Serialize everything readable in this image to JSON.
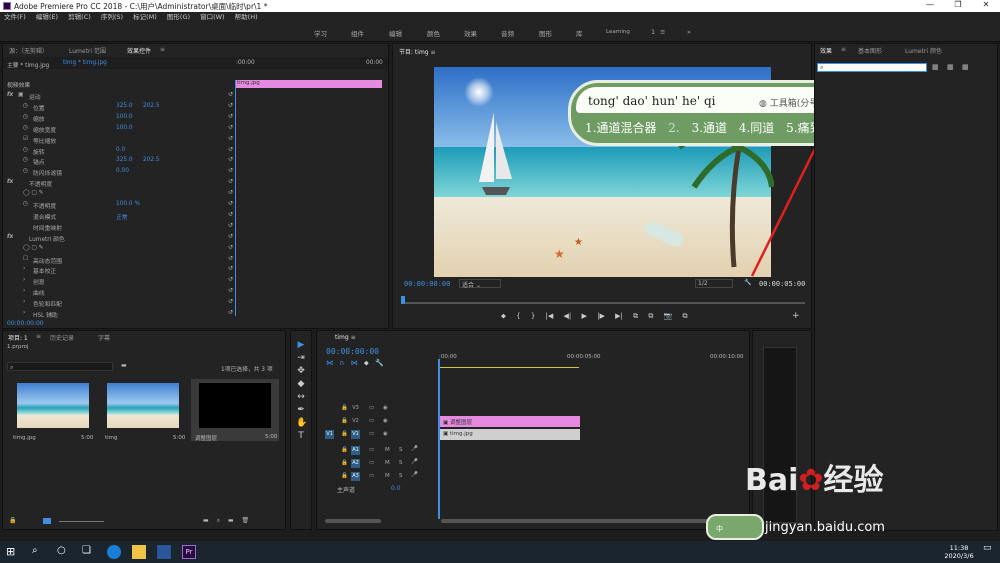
{
  "titlebar": {
    "title": "Adobe Premiere Pro CC 2018 - C:\\用户\\Administrator\\桌面\\临时\\pr\\1 *",
    "minimize": "—",
    "restore": "❐",
    "close": "✕"
  },
  "menu": [
    "文件(F)",
    "编辑(E)",
    "剪辑(C)",
    "序列(S)",
    "标记(M)",
    "图形(G)",
    "窗口(W)",
    "帮助(H)"
  ],
  "workspaces": [
    "学习",
    "组件",
    "编辑",
    "颜色",
    "效果",
    "音频",
    "图形",
    "库",
    "Learning",
    "1",
    "≡",
    "»"
  ],
  "source_panel": {
    "tabs": [
      "源：（无剪辑）",
      "Lumetri 范围",
      "效果控件",
      "≡"
    ],
    "master": "主要 * timg.jpg",
    "clip": "timg * timg.jpg",
    "ruler_start": ":00:00",
    "ruler_end": "00:00",
    "clip_bar": "timg.jpg",
    "video_effects": "视频效果",
    "rows": [
      {
        "fx": "fx",
        "icon": "▣",
        "name": "运动",
        "v1": "",
        "v2": ""
      },
      {
        "fx": "",
        "icon": "◷",
        "name": "位置",
        "v1": "325.0",
        "v2": "202.5"
      },
      {
        "fx": "",
        "icon": "◷",
        "name": "缩放",
        "v1": "100.0",
        "v2": ""
      },
      {
        "fx": "",
        "icon": "◷",
        "name": "缩放宽度",
        "v1": "100.0",
        "v2": ""
      },
      {
        "fx": "",
        "icon": "☑",
        "name": "等比缩放",
        "v1": "",
        "v2": ""
      },
      {
        "fx": "",
        "icon": "◷",
        "name": "旋转",
        "v1": "0.0",
        "v2": ""
      },
      {
        "fx": "",
        "icon": "◷",
        "name": "锚点",
        "v1": "325.0",
        "v2": "202.5"
      },
      {
        "fx": "",
        "icon": "◷",
        "name": "防闪烁滤镜",
        "v1": "0.00",
        "v2": ""
      },
      {
        "fx": "fx",
        "icon": "",
        "name": "不透明度",
        "v1": "",
        "v2": ""
      },
      {
        "fx": "",
        "icon": "◯ ▢ ✎",
        "name": "",
        "v1": "",
        "v2": ""
      },
      {
        "fx": "",
        "icon": "◷",
        "name": "不透明度",
        "v1": "100.0 %",
        "v2": ""
      },
      {
        "fx": "",
        "icon": "",
        "name": "混合模式",
        "v1": "正常",
        "v2": ""
      },
      {
        "fx": "",
        "icon": "",
        "name": "时间重映射",
        "v1": "",
        "v2": ""
      },
      {
        "fx": "fx",
        "icon": "",
        "name": "Lumetri 颜色",
        "v1": "",
        "v2": ""
      },
      {
        "fx": "",
        "icon": "◯ ▢ ✎",
        "name": "",
        "v1": "",
        "v2": ""
      },
      {
        "fx": "",
        "icon": "☐",
        "name": "高动态范围",
        "v1": "",
        "v2": ""
      },
      {
        "fx": "",
        "icon": "›",
        "name": "基本校正",
        "v1": "",
        "v2": ""
      },
      {
        "fx": "",
        "icon": "›",
        "name": "创意",
        "v1": "",
        "v2": ""
      },
      {
        "fx": "",
        "icon": "›",
        "name": "曲线",
        "v1": "",
        "v2": ""
      },
      {
        "fx": "",
        "icon": "›",
        "name": "色轮和匹配",
        "v1": "",
        "v2": ""
      },
      {
        "fx": "",
        "icon": "›",
        "name": "HSL 辅助",
        "v1": "",
        "v2": ""
      }
    ],
    "timecode": "00:00:00:00"
  },
  "program": {
    "tab": "节目: timg",
    "tab_menu": "≡",
    "timecode": "00:00:00:00",
    "fit": "适合",
    "resolution": "1/2",
    "duration": "00:00:05:00",
    "wrench": "🔧",
    "transport": [
      "⬥",
      "{",
      "}",
      "|◀",
      "◀|",
      "▶",
      "|▶",
      "▶|",
      "⧉",
      "⧉",
      "📷",
      "⧉"
    ],
    "add": "+"
  },
  "ime": {
    "pinyin": "tong' dao' hun' he' qi",
    "tool": "工具箱(分号)",
    "candidates": [
      "1.通道混合器",
      "2.",
      "3.通道",
      "4.同道",
      "5.痛到"
    ],
    "nav": "◀ ▶"
  },
  "effects_panel": {
    "tabs": [
      "效果",
      "≡",
      "基本图形",
      "Lumetri 颜色"
    ],
    "search_icon": "⌕",
    "search_value": "",
    "icons": [
      "▦",
      "▦",
      "▦"
    ]
  },
  "project_panel": {
    "tabs": [
      "项目: 1",
      "≡",
      "历史记录",
      "字幕"
    ],
    "project_file": "1.prproj",
    "selection": "1项已选择，共 3 项",
    "items": [
      {
        "name": "timg.jpg",
        "dur": "5:00"
      },
      {
        "name": "timg",
        "dur": "5:00"
      },
      {
        "name": "调整图层",
        "dur": "5:00"
      }
    ]
  },
  "tools": [
    "▶",
    "⇥",
    "✥",
    "◆",
    "↔",
    "✒",
    "✋",
    "T"
  ],
  "timeline": {
    "tab": "timg",
    "tab_menu": "≡",
    "timecode": "00:00:00:00",
    "ruler": [
      ":00:00",
      "00:00:05:00",
      "00:00:10:00"
    ],
    "tracks": [
      {
        "lock": "🔒",
        "name": "V3",
        "sync": "▭",
        "eye": "◉"
      },
      {
        "lock": "🔒",
        "name": "V2",
        "sync": "▭",
        "eye": "◉"
      },
      {
        "lock": "🔒",
        "name": "V1",
        "sync": "▭",
        "eye": "◉",
        "target": "V1"
      },
      {
        "lock": "🔒",
        "name": "A1",
        "sync": "▭",
        "m": "M",
        "s": "S",
        "mic": "🎤"
      },
      {
        "lock": "🔒",
        "name": "A2",
        "sync": "▭",
        "m": "M",
        "s": "S",
        "mic": "🎤"
      },
      {
        "lock": "🔒",
        "name": "A3",
        "sync": "▭",
        "m": "M",
        "s": "S",
        "mic": "🎤"
      }
    ],
    "master": "主声道",
    "master_val": "0.0",
    "clips": {
      "v2": "调整图层",
      "v1": "timg.jpg"
    }
  },
  "watermark": {
    "brand": "Bai",
    "brand2": "经验",
    "url": "jingyan.baidu.com"
  },
  "taskbar": {
    "time": "11:38",
    "date": "2020/3/6",
    "ime": "中"
  },
  "colors": {
    "accent": "#3f8fe3",
    "clip_pink": "#e58ae0",
    "arrow": "#e02020",
    "ime_green": "#7aa86c"
  }
}
